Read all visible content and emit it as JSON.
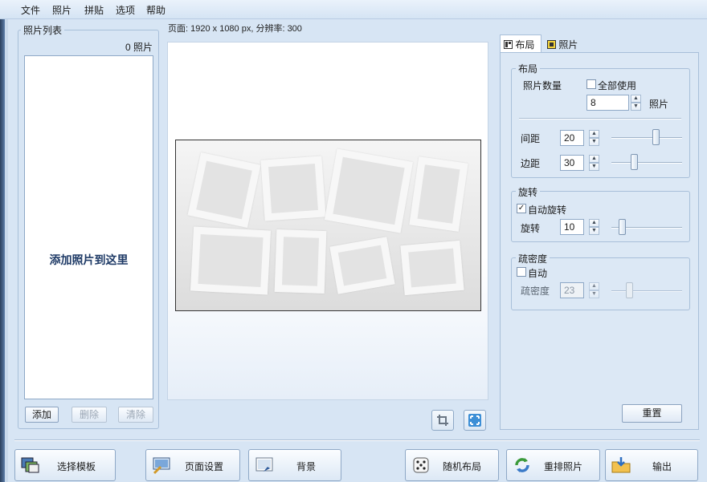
{
  "menu": [
    "文件",
    "照片",
    "拼贴",
    "选项",
    "帮助"
  ],
  "photo_list": {
    "title": "照片列表",
    "count": "0 照片",
    "placeholder": "添加照片到这里",
    "add": "添加",
    "delete": "删除",
    "clear": "清除"
  },
  "page_info": "页面: 1920 x 1080 px, 分辨率: 300",
  "tabs": [
    "布局",
    "照片"
  ],
  "layout": {
    "title": "布局",
    "photo_count_label": "照片数量",
    "use_all": "全部使用",
    "photo_count": "8",
    "photo_unit": "照片",
    "spacing_label": "间距",
    "spacing": "20",
    "spacing_level": 0.65,
    "margin_label": "边距",
    "margin": "30",
    "margin_level": 0.3
  },
  "rotation": {
    "title": "旋转",
    "auto": "自动旋转",
    "auto_checked": true,
    "label": "旋转",
    "value": "10",
    "level": 0.12
  },
  "density": {
    "title": "疏密度",
    "auto": "自动",
    "auto_checked": false,
    "label": "疏密度",
    "value": "23",
    "level": 0.23
  },
  "reset": "重置",
  "bottom_buttons": [
    {
      "label": "选择模板",
      "icon": "template-icon"
    },
    {
      "label": "页面设置",
      "icon": "page-setup-icon"
    },
    {
      "label": "背景",
      "icon": "background-icon"
    },
    {
      "label": "随机布局",
      "icon": "dice-icon"
    },
    {
      "label": "重排照片",
      "icon": "shuffle-icon"
    },
    {
      "label": "输出",
      "icon": "export-icon"
    }
  ],
  "colors": {
    "accent": "#d7e5f4",
    "dark_text": "#1e3a66"
  }
}
